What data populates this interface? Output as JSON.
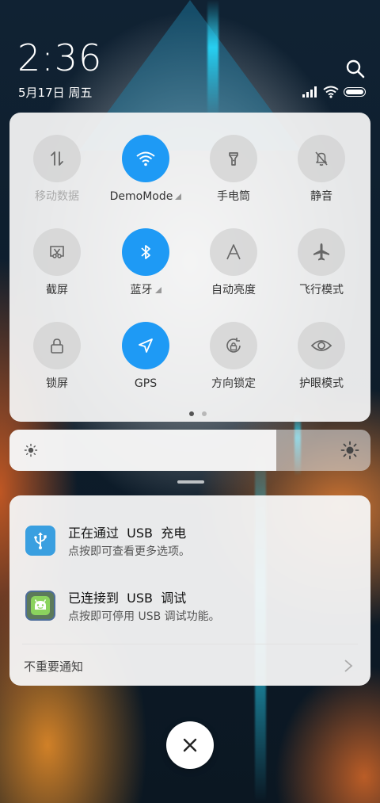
{
  "status_bar": {
    "time": "2:36",
    "date": "5月17日 周五"
  },
  "quick_settings": {
    "tiles": [
      {
        "label": "移动数据",
        "icon": "mobile-data-icon",
        "active": false
      },
      {
        "label": "DemoMode",
        "icon": "wifi-icon",
        "active": true
      },
      {
        "label": "手电筒",
        "icon": "flashlight-icon",
        "active": false
      },
      {
        "label": "静音",
        "icon": "mute-bell-icon",
        "active": false
      },
      {
        "label": "截屏",
        "icon": "screenshot-icon",
        "active": false
      },
      {
        "label": "蓝牙",
        "icon": "bluetooth-icon",
        "active": true
      },
      {
        "label": "自动亮度",
        "icon": "auto-brightness-icon",
        "active": false
      },
      {
        "label": "飞行模式",
        "icon": "airplane-icon",
        "active": false
      },
      {
        "label": "锁屏",
        "icon": "lock-icon",
        "active": false
      },
      {
        "label": "GPS",
        "icon": "gps-icon",
        "active": true
      },
      {
        "label": "方向锁定",
        "icon": "rotation-lock-icon",
        "active": false
      },
      {
        "label": "护眼模式",
        "icon": "eye-icon",
        "active": false
      }
    ],
    "page_count": 2,
    "current_page": 1
  },
  "brightness": {
    "level_fraction": 0.74
  },
  "notifications": [
    {
      "title": "正在通过  USB  充电",
      "text": "点按即可查看更多选项。",
      "icon": "usb-icon",
      "icon_color": "#3a9fe0"
    },
    {
      "title": "已连接到  USB  调试",
      "text": "点按即可停用 USB 调试功能。",
      "icon": "android-icon",
      "icon_color": "#7cc15a"
    }
  ],
  "unimportant_label": "不重要通知",
  "colors": {
    "accent": "#1e9af5",
    "panel": "#f6f6f6"
  }
}
